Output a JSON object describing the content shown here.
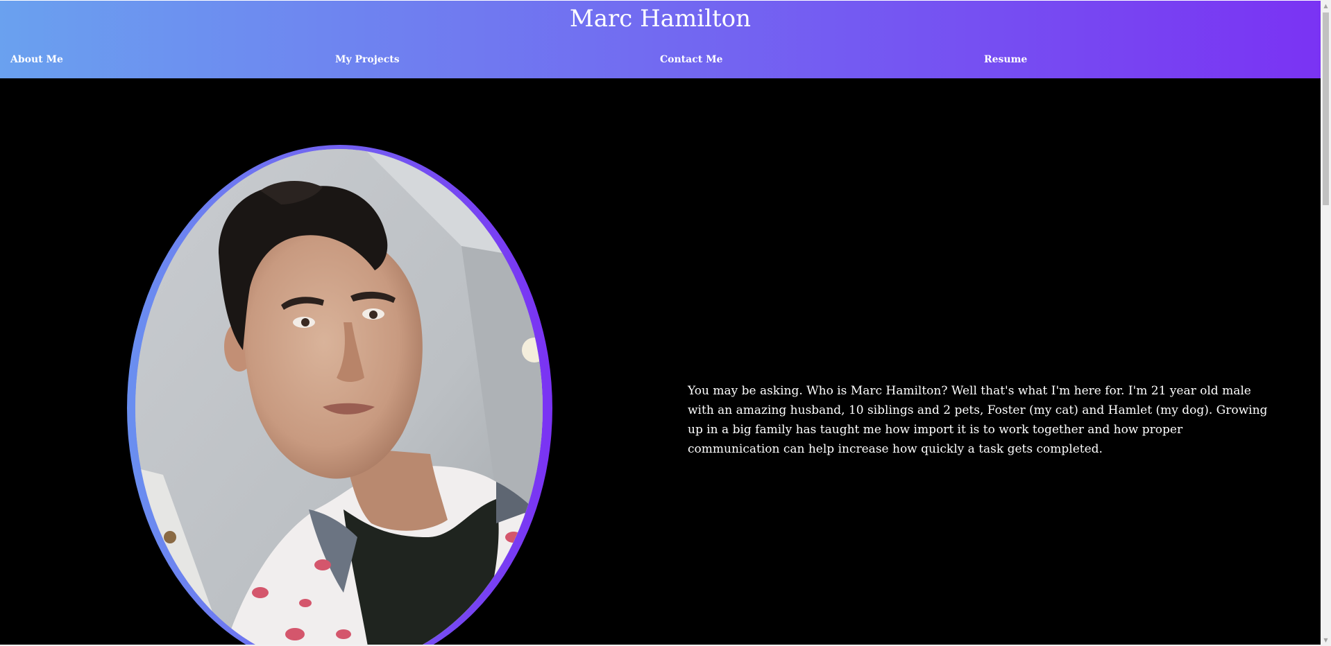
{
  "header": {
    "title": "Marc Hamilton",
    "gradient_start": "#6aa1ef",
    "gradient_end": "#7a33f3",
    "nav": [
      {
        "label": "About Me"
      },
      {
        "label": "My Projects"
      },
      {
        "label": "Contact Me"
      },
      {
        "label": "Resume"
      }
    ]
  },
  "main": {
    "portrait": {
      "alt": "Portrait photo of Marc Hamilton",
      "frame_gradient_start": "#6a8ff0",
      "frame_gradient_end": "#7a33f3"
    },
    "bio": "You may be asking. Who is Marc Hamilton? Well that's what I'm here for. I'm 21 year old male with an amazing husband, 10 siblings and 2 pets, Foster (my cat) and Hamlet (my dog). Growing up in a big family has taught me how import it is to work together and how proper communication can help increase how quickly a task gets completed."
  },
  "colors": {
    "background": "#000000",
    "text": "#ffffff"
  }
}
